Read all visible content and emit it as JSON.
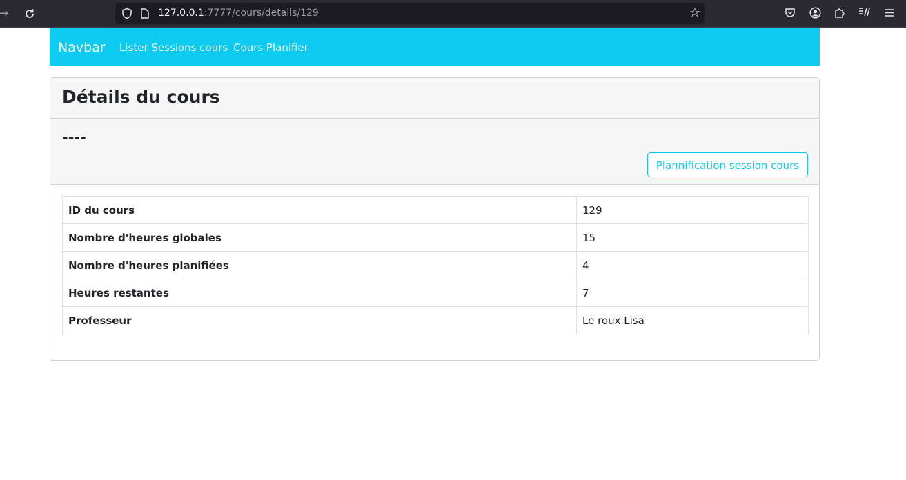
{
  "browser": {
    "url_host": "127.0.0.1",
    "url_rest": ":7777/cours/details/129",
    "icons": [
      "back-arrow-icon",
      "reload-icon",
      "shield-icon",
      "page-icon",
      "bookmark-star-icon",
      "pocket-icon",
      "account-icon",
      "extensions-icon",
      "reader-icon",
      "menu-icon"
    ]
  },
  "navbar": {
    "brand": "Navbar",
    "links": [
      "Lister Sessions cours",
      "Cours Planifier"
    ],
    "color": "#0dcaf0"
  },
  "card": {
    "title": "Détails du cours",
    "subtitle": "----",
    "action_button": "Plannification session cours"
  },
  "details": [
    {
      "label": "ID du cours",
      "value": "129"
    },
    {
      "label": "Nombre d'heures globales",
      "value": "15"
    },
    {
      "label": "Nombre d'heures planifiées",
      "value": "4"
    },
    {
      "label": "Heures restantes",
      "value": "7"
    },
    {
      "label": "Professeur",
      "value": "Le roux Lisa"
    }
  ]
}
